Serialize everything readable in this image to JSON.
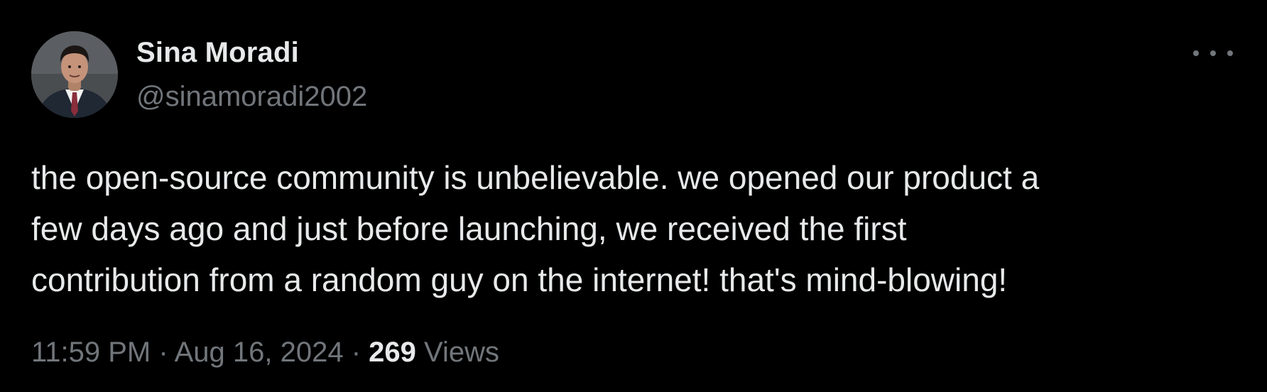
{
  "author": {
    "display_name": "Sina Moradi",
    "handle": "@sinamoradi2002"
  },
  "tweet": {
    "text": "the open-source community is unbelievable. we opened our product a\nfew days ago and just before launching, we received the first\ncontribution from a random guy on the internet! that's mind-blowing!"
  },
  "meta": {
    "time": "11:59 PM",
    "separator": " · ",
    "date": "Aug 16, 2024",
    "views_count": "269",
    "views_label": " Views"
  },
  "icons": {
    "more": "more-horizontal-icon"
  },
  "colors": {
    "background": "#000000",
    "primary_text": "#e7e9ea",
    "secondary_text": "#71767b"
  }
}
